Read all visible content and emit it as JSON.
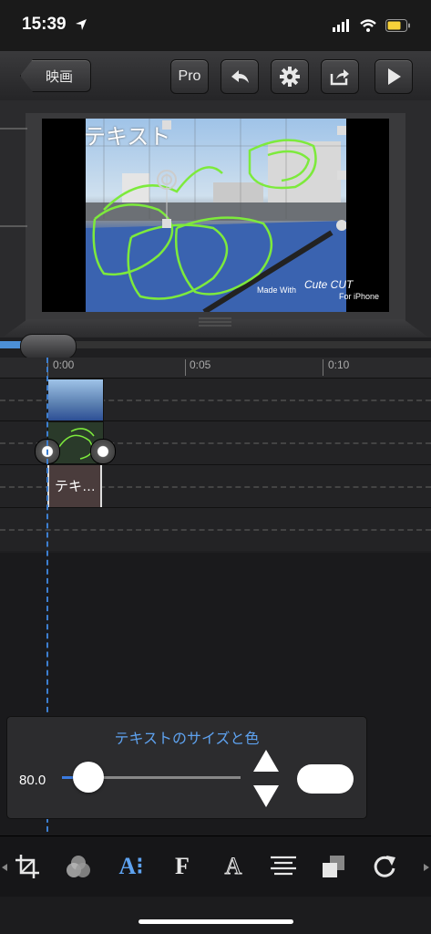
{
  "status_bar": {
    "time": "15:39"
  },
  "toolbar": {
    "back_label": "映画",
    "pro_label": "Pro"
  },
  "preview": {
    "overlay_text": "テキスト",
    "watermark_prefix": "Made With",
    "watermark_logo": "Cute CUT",
    "watermark_suffix": "For iPhone"
  },
  "timeline": {
    "ticks": [
      "0:00",
      "0:05",
      "0:10"
    ],
    "text_clip_label": "テキ…"
  },
  "text_panel": {
    "title": "テキストのサイズと色",
    "size_value": "80.0",
    "slider_level": 0.15
  },
  "colors": {
    "accent_blue": "#5ea2ef",
    "playhead": "#3d7fd1",
    "drawing_green": "#7dea3c"
  },
  "icons": {
    "bottom_tools": [
      "crop-icon",
      "color-filter-icon",
      "text-style-icon",
      "font-icon",
      "text-outline-icon",
      "align-icon",
      "layer-order-icon",
      "redo-icon"
    ]
  }
}
